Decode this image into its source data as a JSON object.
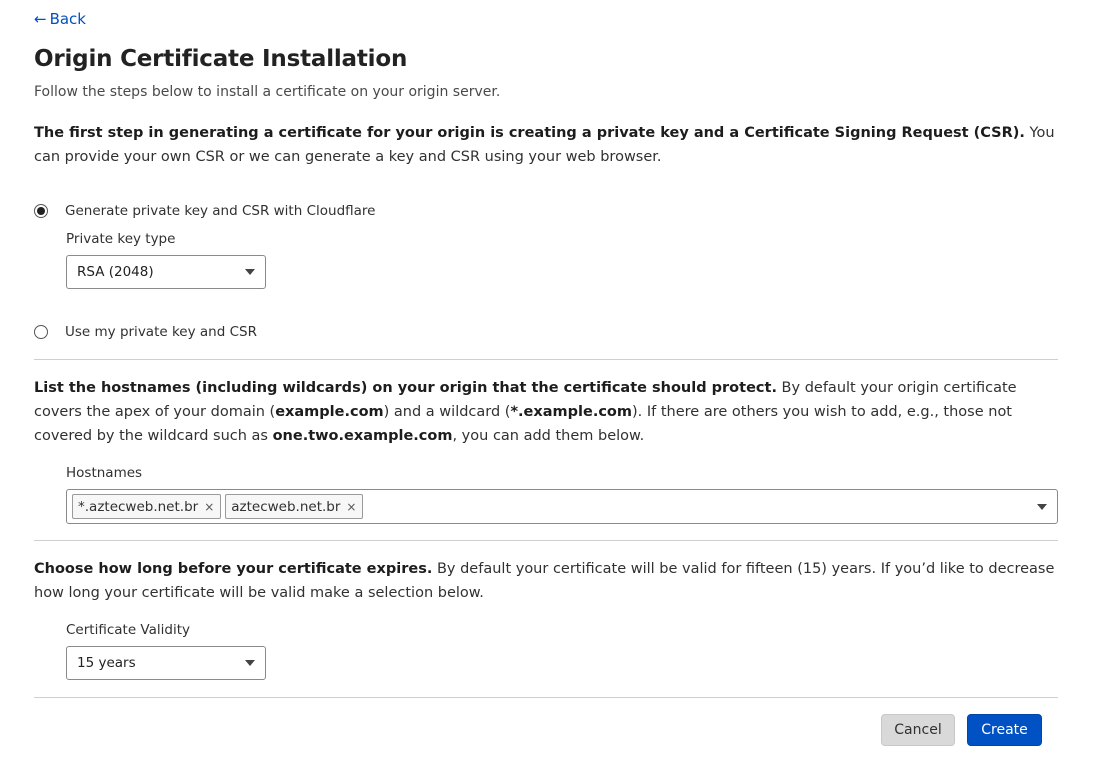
{
  "nav": {
    "back_label": "Back",
    "back_arrow": "←"
  },
  "page": {
    "title": "Origin Certificate Installation",
    "subtitle": "Follow the steps below to install a certificate on your origin server."
  },
  "step_key": {
    "intro_bold": "The first step in generating a certificate for your origin is creating a private key and a Certificate Signing Request (CSR).",
    "intro_rest": " You can provide your own CSR or we can generate a key and CSR using your web browser.",
    "options": [
      {
        "label": "Generate private key and CSR with Cloudflare",
        "selected": true
      },
      {
        "label": "Use my private key and CSR",
        "selected": false
      }
    ],
    "key_type_label": "Private key type",
    "key_type_value": "RSA (2048)"
  },
  "step_hosts": {
    "intro_bold": "List the hostnames (including wildcards) on your origin that the certificate should protect.",
    "intro_1": " By default your origin certificate covers the apex of your domain (",
    "apex": "example.com",
    "intro_2": ") and a wildcard (",
    "wildcard": "*.example.com",
    "intro_3": "). If there are others you wish to add, e.g., those not covered by the wildcard such as ",
    "example_host": "one.two.example.com",
    "intro_4": ", you can add them below.",
    "hostnames_label": "Hostnames",
    "hostnames": [
      "*.aztecweb.net.br",
      "aztecweb.net.br"
    ],
    "remove_glyph": "×"
  },
  "step_validity": {
    "intro_bold": "Choose how long before your certificate expires.",
    "intro_rest": " By default your certificate will be valid for fifteen (15) years. If you’d like to decrease how long your certificate will be valid make a selection below.",
    "validity_label": "Certificate Validity",
    "validity_value": "15 years"
  },
  "actions": {
    "cancel_label": "Cancel",
    "create_label": "Create"
  },
  "colors": {
    "accent": "#0051c3",
    "cancel_bg": "#d9d9d9",
    "text": "#313131",
    "divider": "#cfcfcf"
  }
}
